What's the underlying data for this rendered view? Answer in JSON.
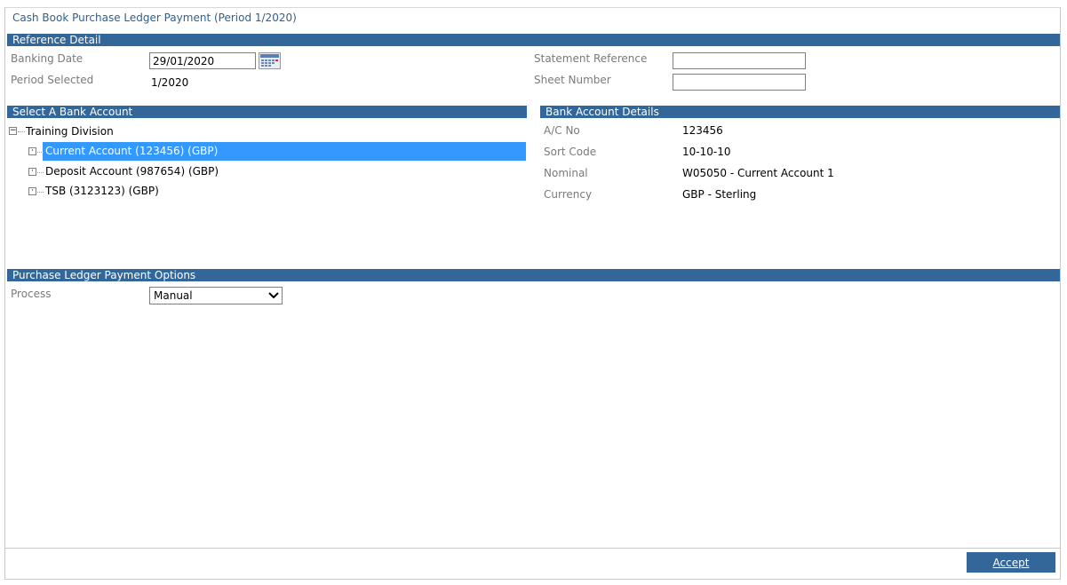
{
  "window": {
    "title": "Cash Book Purchase Ledger Payment (Period 1/2020)"
  },
  "reference_detail": {
    "header": "Reference Detail",
    "banking_date_label": "Banking Date",
    "banking_date_value": "29/01/2020",
    "period_selected_label": "Period Selected",
    "period_selected_value": "1/2020",
    "statement_reference_label": "Statement Reference",
    "statement_reference_value": "",
    "sheet_number_label": "Sheet Number",
    "sheet_number_value": ""
  },
  "bank_select": {
    "header": "Select A Bank Account",
    "root": "Training Division",
    "accounts": [
      {
        "label": "Current Account (123456) (GBP)",
        "selected": true
      },
      {
        "label": "Deposit Account (987654) (GBP)",
        "selected": false
      },
      {
        "label": "TSB (3123123) (GBP)",
        "selected": false
      }
    ]
  },
  "bank_details": {
    "header": "Bank Account Details",
    "ac_no_label": "A/C No",
    "ac_no_value": "123456",
    "sort_code_label": "Sort Code",
    "sort_code_value": "10-10-10",
    "nominal_label": "Nominal",
    "nominal_value": "W05050 - Current Account 1",
    "currency_label": "Currency",
    "currency_value": "GBP - Sterling"
  },
  "payment_options": {
    "header": "Purchase Ledger Payment Options",
    "process_label": "Process",
    "process_value": "Manual"
  },
  "footer": {
    "accept_label": "Accept"
  },
  "colors": {
    "header_bar": "#336699",
    "selection": "#3399ff",
    "title_text": "#2e5f8f"
  }
}
